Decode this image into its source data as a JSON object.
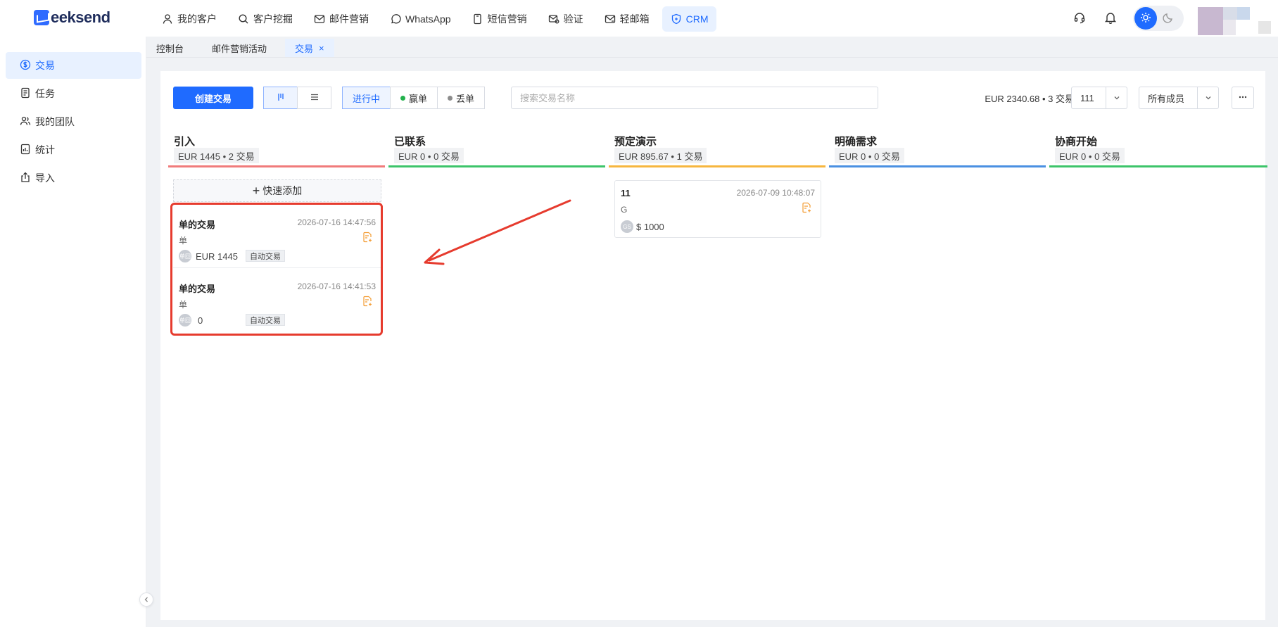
{
  "brand": {
    "name": "eeksend",
    "accent": "#1f6bff"
  },
  "nav": [
    {
      "label": "我的客户",
      "icon": "user-icon"
    },
    {
      "label": "客户挖掘",
      "icon": "search-icon"
    },
    {
      "label": "邮件营销",
      "icon": "mail-icon"
    },
    {
      "label": "WhatsApp",
      "icon": "whatsapp-icon"
    },
    {
      "label": "短信营销",
      "icon": "sms-icon"
    },
    {
      "label": "验证",
      "icon": "verify-mail-icon"
    },
    {
      "label": "轻邮箱",
      "icon": "mailbox-icon"
    },
    {
      "label": "CRM",
      "icon": "crm-icon",
      "active": true
    }
  ],
  "tabs": [
    {
      "label": "控制台"
    },
    {
      "label": "邮件营销活动"
    },
    {
      "label": "交易",
      "active": true,
      "close": "×"
    }
  ],
  "sidebar": {
    "items": [
      {
        "label": "交易",
        "icon": "dollar-icon",
        "active": true
      },
      {
        "label": "任务",
        "icon": "task-icon"
      },
      {
        "label": "我的团队",
        "icon": "team-icon"
      },
      {
        "label": "统计",
        "icon": "stats-icon"
      },
      {
        "label": "导入",
        "icon": "import-icon"
      }
    ]
  },
  "toolbar": {
    "create_label": "创建交易",
    "status": {
      "in_progress": "进行中",
      "won": "赢单",
      "lost": "丢单"
    },
    "won_color": "#22b14c",
    "lost_color": "#8c8c8c",
    "search_placeholder": "搜索交易名称",
    "summary": "EUR 2340.68 • 3 交易",
    "pipeline_value": "111",
    "members_value": "所有成员"
  },
  "board": {
    "quick_add": "快速添加",
    "columns": [
      {
        "title": "引入",
        "stat": "EUR 1445 • 2 交易",
        "color": "#f07b7b"
      },
      {
        "title": "已联系",
        "stat": "EUR 0 • 0 交易",
        "color": "#3cc46a"
      },
      {
        "title": "预定演示",
        "stat": "EUR 895.67 • 1 交易",
        "color": "#f6b63e"
      },
      {
        "title": "明确需求",
        "stat": "EUR 0 • 0 交易",
        "color": "#4a90e2"
      },
      {
        "title": "协商开始",
        "stat": "EUR 0 • 0 交易",
        "color": "#3cc46a"
      }
    ],
    "cards": [
      {
        "title": "单的交易",
        "time": "2026-07-16 14:47:56",
        "sub": "单",
        "avatar": "单回",
        "amount": "EUR 1445",
        "tag": "自动交易"
      },
      {
        "title": "单的交易",
        "time": "2026-07-16 14:41:53",
        "sub": "单",
        "avatar": "单回",
        "amount": "0",
        "tag": "自动交易"
      },
      {
        "title": "11",
        "time": "2026-07-09 10:48:07",
        "sub": "G",
        "avatar": "GS",
        "amount": "$ 1000"
      }
    ]
  },
  "annotation": {
    "color": "#e63b2e"
  }
}
